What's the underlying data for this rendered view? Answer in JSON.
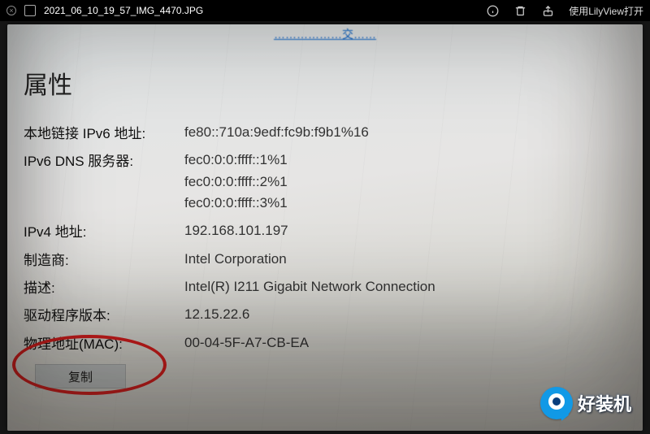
{
  "titlebar": {
    "filename": "2021_06_10_19_57_IMG_4470.JPG",
    "open_with": "使用LilyView打开"
  },
  "page": {
    "top_marker": "………………交……",
    "heading": "属性",
    "rows": [
      {
        "label": "本地链接 IPv6 地址:",
        "values": [
          "fe80::710a:9edf:fc9b:f9b1%16"
        ]
      },
      {
        "label": "IPv6 DNS 服务器:",
        "values": [
          "fec0:0:0:ffff::1%1",
          "fec0:0:0:ffff::2%1",
          "fec0:0:0:ffff::3%1"
        ]
      },
      {
        "label": "IPv4 地址:",
        "values": [
          "192.168.101.197"
        ]
      },
      {
        "label": "制造商:",
        "values": [
          "Intel Corporation"
        ]
      },
      {
        "label": "描述:",
        "values": [
          "Intel(R) I211 Gigabit Network Connection"
        ]
      },
      {
        "label": "驱动程序版本:",
        "values": [
          "12.15.22.6"
        ]
      },
      {
        "label": "物理地址(MAC):",
        "values": [
          "00-04-5F-A7-CB-EA"
        ]
      }
    ],
    "copy_button": "复制"
  },
  "watermark": {
    "text": "好装机"
  }
}
